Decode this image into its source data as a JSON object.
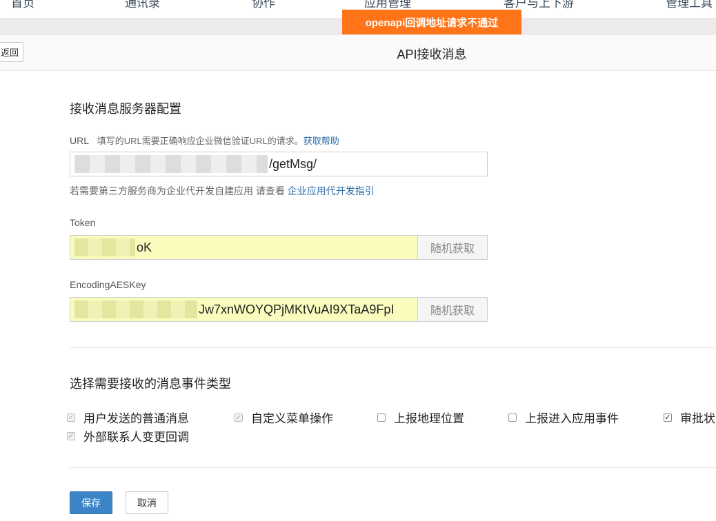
{
  "nav": {
    "items": [
      "首页",
      "通讯录",
      "协作",
      "应用管理",
      "客户与上下游",
      "管理工具"
    ]
  },
  "alert": {
    "text": "openapi回调地址请求不通过"
  },
  "header": {
    "back_label": "返回",
    "title": "API接收消息"
  },
  "server_config": {
    "title": "接收消息服务器配置",
    "url_label": "URL",
    "url_hint": "填写的URL需要正确响应企业微信验证URL的请求。",
    "url_help_link": "获取帮助",
    "url_value": "/getMsg/",
    "third_party_hint": "若需要第三方服务商为企业代开发自建应用 请查看",
    "third_party_link": "企业应用代开发指引",
    "token_label": "Token",
    "token_value": "oK",
    "random_label": "随机获取",
    "aes_label": "EncodingAESKey",
    "aes_value": "Jw7xnWOYQPjMKtVuAI9XTaA9FpI"
  },
  "events": {
    "title": "选择需要接收的消息事件类型",
    "options": [
      {
        "label": "用户发送的普通消息",
        "checked": true,
        "disabled": true
      },
      {
        "label": "自定义菜单操作",
        "checked": true,
        "disabled": true
      },
      {
        "label": "上报地理位置",
        "checked": false,
        "disabled": false
      },
      {
        "label": "上报进入应用事件",
        "checked": false,
        "disabled": false
      },
      {
        "label": "审批状",
        "checked": true,
        "disabled": false
      },
      {
        "label": "外部联系人变更回调",
        "checked": true,
        "disabled": true
      }
    ]
  },
  "actions": {
    "save_label": "保存",
    "cancel_label": "取消"
  },
  "colors": {
    "alert": "#ff7418",
    "primary": "#3b84c8",
    "link": "#2b6aa8"
  }
}
